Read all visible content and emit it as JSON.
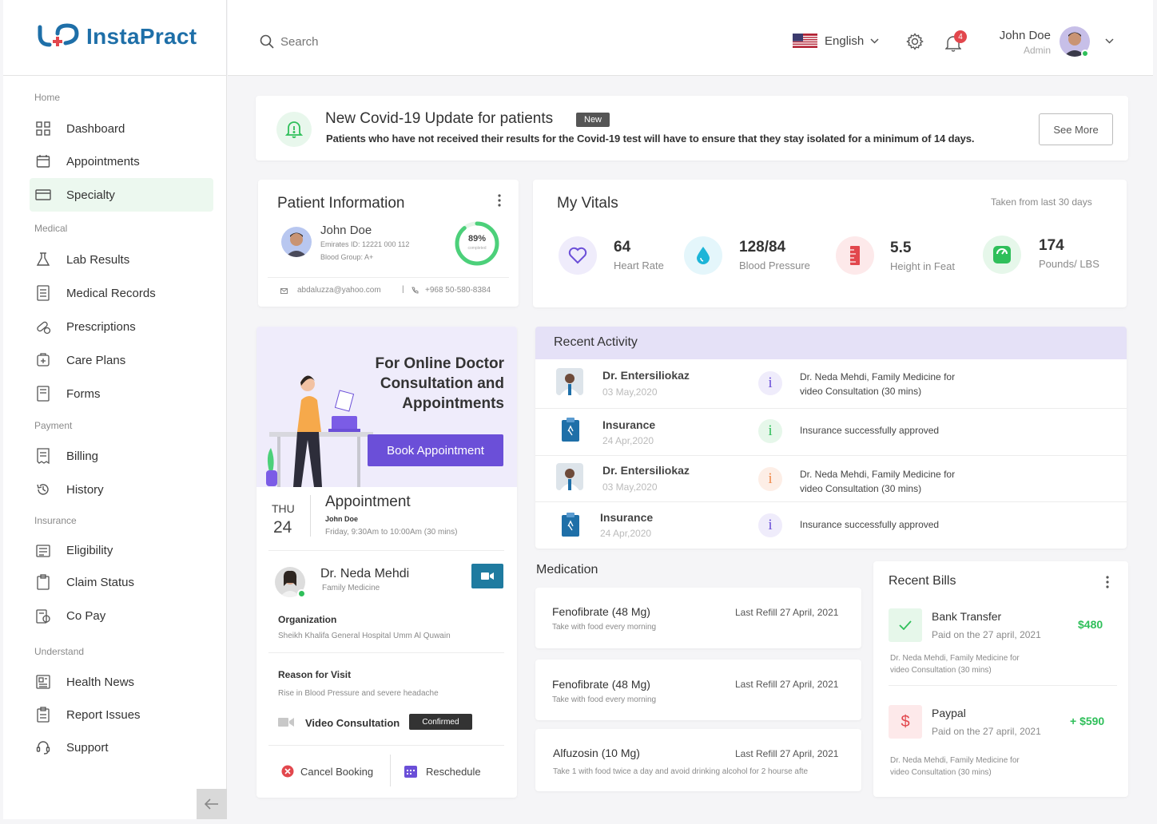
{
  "app": {
    "name": "InstaPract"
  },
  "sidebar": {
    "sections": [
      "Home",
      "Medical",
      "Payment",
      "Insurance",
      "Understand"
    ],
    "items": [
      {
        "label": "Dashboard",
        "icon": "dashboard-icon"
      },
      {
        "label": "Appointments",
        "icon": "calendar-icon"
      },
      {
        "label": "Specialty",
        "icon": "specialty-icon"
      },
      {
        "label": "Lab Results",
        "icon": "flask-icon"
      },
      {
        "label": "Medical Records",
        "icon": "records-icon"
      },
      {
        "label": "Prescriptions",
        "icon": "pill-icon"
      },
      {
        "label": "Care Plans",
        "icon": "care-plan-icon"
      },
      {
        "label": "Forms",
        "icon": "forms-icon"
      },
      {
        "label": "Billing",
        "icon": "billing-icon"
      },
      {
        "label": "History",
        "icon": "history-icon"
      },
      {
        "label": "Eligibility",
        "icon": "eligibility-icon"
      },
      {
        "label": "Claim Status",
        "icon": "clipboard-icon"
      },
      {
        "label": "Co Pay",
        "icon": "copay-icon"
      },
      {
        "label": "Health News",
        "icon": "news-icon"
      },
      {
        "label": "Report Issues",
        "icon": "report-icon"
      },
      {
        "label": "Support",
        "icon": "support-icon"
      }
    ]
  },
  "header": {
    "search_placeholder": "Search",
    "language": "English",
    "notification_count": "4",
    "user_name": "John Doe",
    "user_role": "Admin"
  },
  "banner": {
    "title": "New Covid-19 Update for patients",
    "badge": "New",
    "text": "Patients who have not received their results for the Covid-19 test will have to ensure that they stay isolated for a minimum of 14 days.",
    "button": "See More"
  },
  "patient": {
    "title": "Patient Information",
    "name": "John Doe",
    "emirates_id": "Emirates ID: 12221 000 112",
    "blood_group": "Blood Group: A+",
    "progress_label": "89%",
    "progress_sub": "completed",
    "progress_value": 0.89,
    "email": "abdaluzza@yahoo.com",
    "phone": "+968 50-580-8384"
  },
  "vitals": {
    "title": "My Vitals",
    "note": "Taken from last 30 days",
    "items": [
      {
        "value": "64",
        "label": "Heart Rate"
      },
      {
        "value": "128/84",
        "label": "Blood Pressure"
      },
      {
        "value": "5.5",
        "label": "Height in Feat"
      },
      {
        "value": "174",
        "label": "Pounds/ LBS"
      }
    ]
  },
  "promo": {
    "line1": "For Online Doctor",
    "line2": "Consultation and",
    "line3": "Appointments",
    "button": "Book Appointment"
  },
  "appointment": {
    "day": "THU",
    "date": "24",
    "title": "Appointment",
    "patient": "John Doe",
    "time": "Friday, 9:30Am to 10:00Am (30 mins)",
    "doctor": "Dr. Neda Mehdi",
    "specialty": "Family Medicine",
    "org_label": "Organization",
    "org": "Sheikh Khalifa General Hospital Umm Al Quwain",
    "reason_label": "Reason for Visit",
    "reason": "Rise in Blood Pressure and severe headache",
    "type": "Video Consultation",
    "status": "Confirmed",
    "cancel": "Cancel Booking",
    "reschedule": "Reschedule"
  },
  "activity": {
    "title": "Recent Activity",
    "rows": [
      {
        "name": "Dr. Entersiliokaz",
        "date": "03 May,2020",
        "desc1": "Dr. Neda Mehdi, Family Medicine for",
        "desc2": "video Consultation (30 mins)"
      },
      {
        "name": "Insurance",
        "date": "24 Apr,2020",
        "desc1": "Insurance successfully approved",
        "desc2": ""
      },
      {
        "name": "Dr. Entersiliokaz",
        "date": "03 May,2020",
        "desc1": "Dr. Neda Mehdi, Family Medicine for",
        "desc2": "video Consultation (30 mins)"
      },
      {
        "name": "Insurance",
        "date": "24 Apr,2020",
        "desc1": "Insurance successfully approved",
        "desc2": ""
      }
    ]
  },
  "medication": {
    "title": "Medication",
    "items": [
      {
        "name": "Fenofibrate (48 Mg)",
        "refill": "Last Refill 27 April, 2021",
        "note": "Take with food every morning"
      },
      {
        "name": "Fenofibrate (48 Mg)",
        "refill": "Last Refill 27 April, 2021",
        "note": "Take with food every morning"
      },
      {
        "name": "Alfuzosin (10 Mg)",
        "refill": "Last Refill 27 April, 2021",
        "note": "Take 1 with food twice a day and avoid  drinking alcohol for 2 hourse afte"
      }
    ]
  },
  "bills": {
    "title": "Recent Bills",
    "items": [
      {
        "method": "Bank Transfer",
        "paid": "Paid on the 27 april, 2021",
        "amount": "$480",
        "desc1": "Dr. Neda Mehdi, Family Medicine for",
        "desc2": "video Consultation (30 mins)"
      },
      {
        "method": "Paypal",
        "paid": "Paid on the 27 april, 2021",
        "amount": "+ $590",
        "desc1": "Dr. Neda Mehdi, Family Medicine for",
        "desc2": "video Consultation (30 mins)"
      }
    ]
  },
  "colors": {
    "accent": "#6b4fd8",
    "green": "#2fbf5a",
    "brand": "#1e6fa8",
    "red": "#e2474d",
    "teal": "#1f7ba0"
  }
}
